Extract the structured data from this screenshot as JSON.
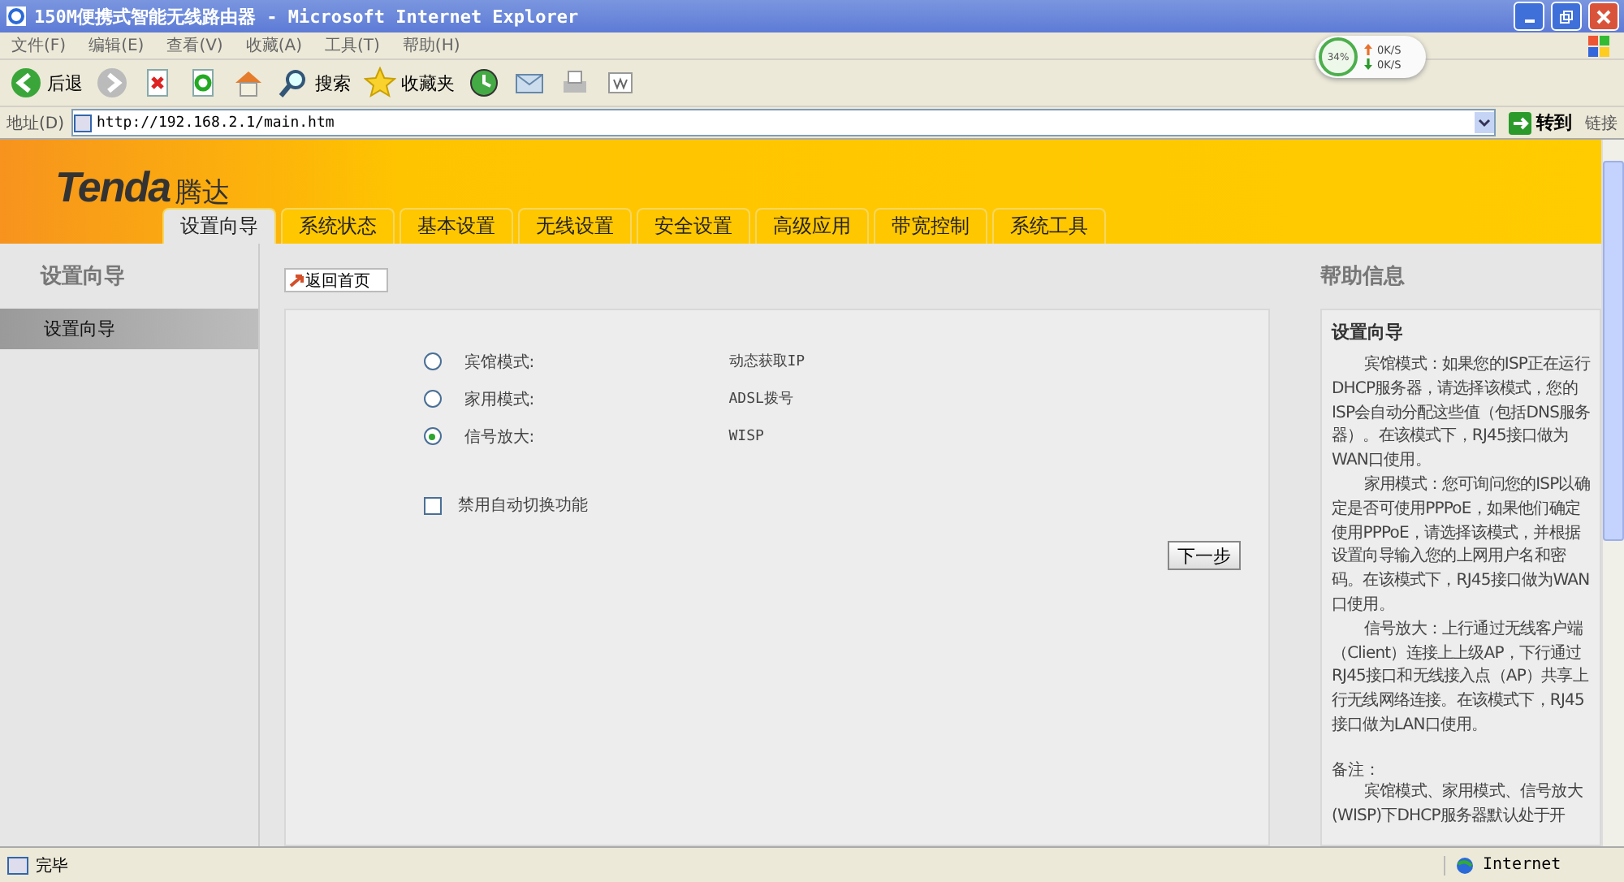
{
  "window": {
    "title": "150M便携式智能无线路由器 - Microsoft Internet Explorer"
  },
  "menu": [
    "文件(F)",
    "编辑(E)",
    "查看(V)",
    "收藏(A)",
    "工具(T)",
    "帮助(H)"
  ],
  "toolbar": [
    {
      "kind": "back",
      "label": "后退"
    },
    {
      "kind": "forward"
    },
    {
      "kind": "stop"
    },
    {
      "kind": "refresh"
    },
    {
      "kind": "home"
    },
    {
      "kind": "search",
      "label": "搜索"
    },
    {
      "kind": "favorites",
      "label": "收藏夹"
    },
    {
      "kind": "history"
    },
    {
      "kind": "mail"
    },
    {
      "kind": "print"
    },
    {
      "kind": "edit"
    }
  ],
  "net_monitor": {
    "percent": "34%",
    "up": "0K/S",
    "down": "0K/S"
  },
  "address": {
    "label": "地址(D)",
    "url": "http://192.168.2.1/main.htm",
    "go": "转到",
    "links": "链接"
  },
  "page": {
    "logo": "Tenda",
    "brand": "腾达",
    "tabs": [
      {
        "label": "设置向导",
        "selected": true
      },
      {
        "label": "系统状态",
        "selected": false
      },
      {
        "label": "基本设置",
        "selected": false
      },
      {
        "label": "无线设置",
        "selected": false
      },
      {
        "label": "安全设置",
        "selected": false
      },
      {
        "label": "高级应用",
        "selected": false
      },
      {
        "label": "带宽控制",
        "selected": false
      },
      {
        "label": "系统工具",
        "selected": false
      }
    ],
    "sidebar": {
      "title": "设置向导",
      "items": [
        {
          "label": "设置向导",
          "selected": true
        }
      ]
    },
    "back_button": "返回首页",
    "modes": [
      {
        "label": "宾馆模式:",
        "value": "动态获取IP",
        "selected": false
      },
      {
        "label": "家用模式:",
        "value": "ADSL拨号",
        "selected": false
      },
      {
        "label": "信号放大:",
        "value": "WISP",
        "selected": true
      }
    ],
    "auto_switch": {
      "label": "禁用自动切换功能",
      "checked": false
    },
    "next_button": "下一步",
    "help": {
      "title": "帮助信息",
      "heading": "设置向导",
      "paragraphs": [
        "宾馆模式：如果您的ISP正在运行DHCP服务器，请选择该模式，您的ISP会自动分配这些值（包括DNS服务器）。在该模式下，RJ45接口做为WAN口使用。",
        "家用模式：您可询问您的ISP以确定是否可使用PPPoE，如果他们确定使用PPPoE，请选择该模式，并根据设置向导输入您的上网用户名和密码。在该模式下，RJ45接口做为WAN口使用。",
        "信号放大：上行通过无线客户端（Client）连接上上级AP，下行通过RJ45接口和无线接入点（AP）共享上行无线网络连接。在该模式下，RJ45接口做为LAN口使用。"
      ],
      "note_title": "备注：",
      "note": "宾馆模式、家用模式、信号放大(WISP)下DHCP服务器默认处于开"
    }
  },
  "status_bar": {
    "text": "完毕",
    "zone": "Internet"
  }
}
